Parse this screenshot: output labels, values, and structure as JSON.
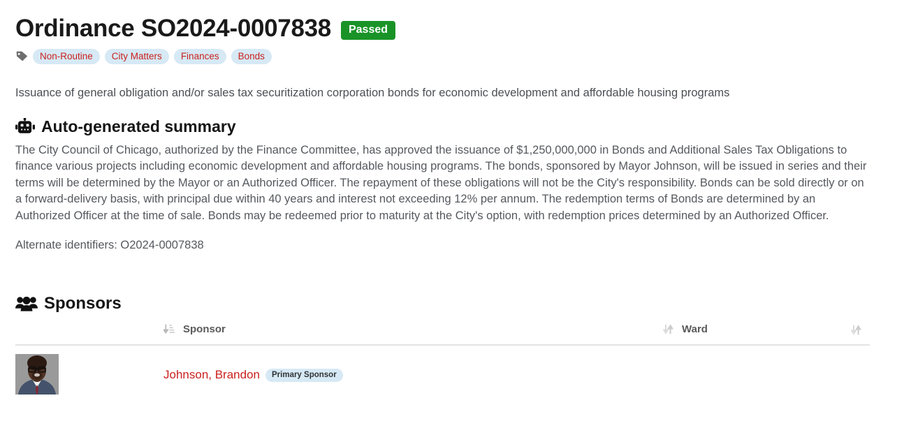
{
  "header": {
    "title": "Ordinance SO2024-0007838",
    "status_badge": "Passed",
    "status_color": "#199327",
    "tag_icon": "tag-icon",
    "tags": [
      {
        "label": "Non-Routine"
      },
      {
        "label": "City Matters"
      },
      {
        "label": "Finances"
      },
      {
        "label": "Bonds"
      }
    ],
    "tag_text_color": "#c9211e",
    "tag_bg_color": "#d6e9f5"
  },
  "description": "Issuance of general obligation and/or sales tax securitization corporation bonds for economic development and affordable housing programs",
  "summary": {
    "icon": "robot-icon",
    "heading": "Auto-generated summary",
    "body": "The City Council of Chicago, authorized by the Finance Committee, has approved the issuance of $1,250,000,000 in Bonds and Additional Sales Tax Obligations to finance various projects including economic development and affordable housing programs. The bonds, sponsored by Mayor Johnson, will be issued in series and their terms will be determined by the Mayor or an Authorized Officer. The repayment of these obligations will not be the City's responsibility. Bonds can be sold directly or on a forward-delivery basis, with principal due within 40 years and interest not exceeding 12% per annum. The redemption terms of Bonds are determined by an Authorized Officer at the time of sale. Bonds may be redeemed prior to maturity at the City's option, with redemption prices determined by an Authorized Officer.",
    "alternate_identifiers": "Alternate identifiers: O2024-0007838"
  },
  "sponsors": {
    "icon": "users-icon",
    "heading": "Sponsors",
    "columns": [
      {
        "label": "",
        "sort_icon": ""
      },
      {
        "label": "Sponsor",
        "sort_icon": "sort-amount-down-icon"
      },
      {
        "label": "Ward",
        "sort_icon": "sort-up-down-icon"
      },
      {
        "label": "",
        "sort_icon": "sort-up-down-icon"
      }
    ],
    "rows": [
      {
        "avatar": "sponsor-photo",
        "name": "Johnson, Brandon",
        "badge": "Primary Sponsor",
        "ward": ""
      }
    ]
  }
}
